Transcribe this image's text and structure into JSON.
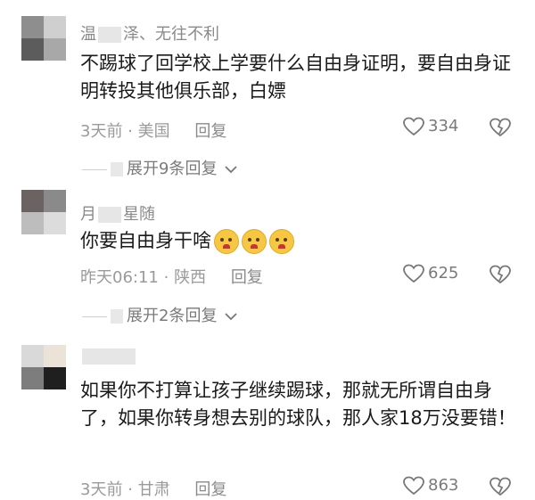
{
  "comments": [
    {
      "name_prefix": "温",
      "name_suffix": "泽、无往不利",
      "text": "不踢球了回学校上学要什么自由身证明，要自由身证明转投其他俱乐部，白嫖",
      "time": "3天前",
      "location": "美国",
      "reply_label": "回复",
      "likes": "334",
      "expand": "展开9条回复",
      "avatar_colors": [
        "#8e8e8e",
        "#cfcfcf",
        "#5c5c5c",
        "#a8a8a8"
      ]
    },
    {
      "name_prefix": "月",
      "name_suffix": "星随",
      "text": "你要自由身干啥",
      "emoji": [
        "pleading-face-emoji",
        "pleading-face-emoji",
        "pleading-face-emoji"
      ],
      "time": "昨天06:11",
      "location": "陕西",
      "reply_label": "回复",
      "likes": "625",
      "expand": "展开2条回复",
      "avatar_colors": [
        "#6b6362",
        "#8a8a8a",
        "#bdbdbd",
        "#dcdcdc"
      ]
    },
    {
      "name_prefix": "",
      "name_suffix": "",
      "text": "如果你不打算让孩子继续踢球，那就无所谓自由身了，如果你转身想去别的球队，那人家18万没要错！",
      "time": "3天前",
      "location": "甘肃",
      "reply_label": "回复",
      "likes": "863",
      "avatar_colors": [
        "#d9d9d9",
        "#ece3d8",
        "#7d7d7d",
        "#1f1f1f"
      ]
    }
  ],
  "separator": "·",
  "icons": {
    "like": "heart-outline-icon",
    "dislike": "broken-heart-icon",
    "expand": "chevron-down-icon"
  }
}
